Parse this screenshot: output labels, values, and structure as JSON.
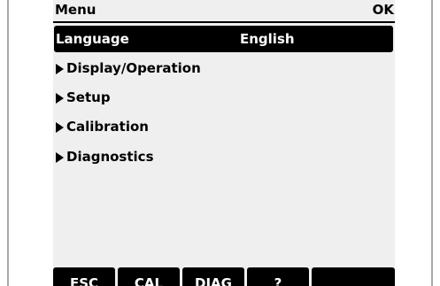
{
  "header": {
    "title": "Menu",
    "ok_label": "OK"
  },
  "menu": {
    "language": {
      "label": "Language",
      "value": "English"
    },
    "items": [
      {
        "label": "Display/Operation",
        "icon": "triangle-right-icon"
      },
      {
        "label": "Setup",
        "icon": "triangle-right-icon"
      },
      {
        "label": "Calibration",
        "icon": "triangle-right-icon"
      },
      {
        "label": "Diagnostics",
        "icon": "triangle-right-icon"
      }
    ]
  },
  "softkeys": [
    {
      "label": "ESC"
    },
    {
      "label": "CAL"
    },
    {
      "label": "DIAG"
    },
    {
      "label": "?"
    },
    {
      "label": ""
    }
  ],
  "colors": {
    "screen_bg": "#efefef",
    "foreground": "#000000",
    "selected_text": "#ffffff"
  }
}
